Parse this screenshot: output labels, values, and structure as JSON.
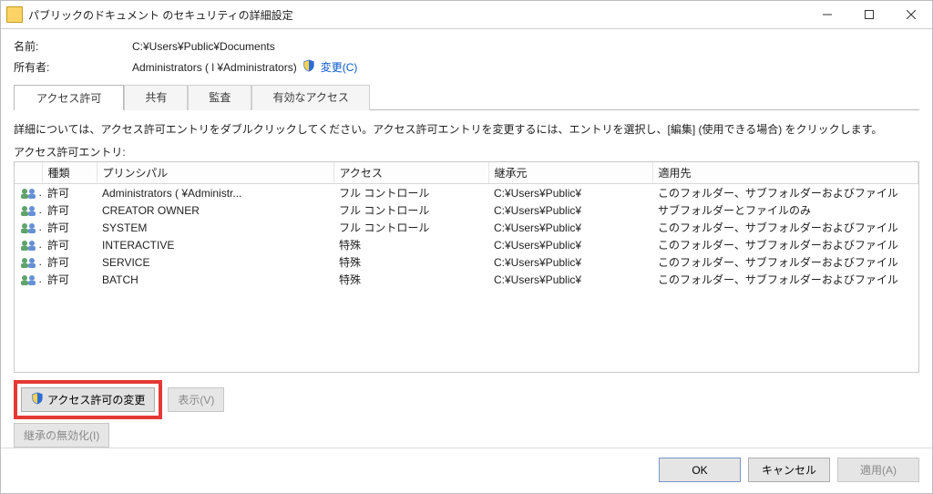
{
  "window": {
    "title": "パブリックのドキュメント のセキュリティの詳細設定"
  },
  "meta": {
    "name_label": "名前:",
    "name_value": "C:¥Users¥Public¥Documents",
    "owner_label": "所有者:",
    "owner_value": "Administrators ( l              ¥Administrators)",
    "change_link": "変更(C)"
  },
  "tabs": {
    "perm": "アクセス許可",
    "share": "共有",
    "audit": "監査",
    "effective": "有効なアクセス"
  },
  "description": "詳細については、アクセス許可エントリをダブルクリックしてください。アクセス許可エントリを変更するには、エントリを選択し、[編集] (使用できる場合) をクリックします。",
  "entries_label": "アクセス許可エントリ:",
  "columns": {
    "icon": "",
    "type": "種類",
    "principal": "プリンシパル",
    "access": "アクセス",
    "inherited": "継承元",
    "applies": "適用先"
  },
  "rows": [
    {
      "type": "許可",
      "principal": "Administrators (               ¥Administr...",
      "access": "フル コントロール",
      "inherited": "C:¥Users¥Public¥",
      "applies": "このフォルダー、サブフォルダーおよびファイル"
    },
    {
      "type": "許可",
      "principal": "CREATOR OWNER",
      "access": "フル コントロール",
      "inherited": "C:¥Users¥Public¥",
      "applies": "サブフォルダーとファイルのみ"
    },
    {
      "type": "許可",
      "principal": "SYSTEM",
      "access": "フル コントロール",
      "inherited": "C:¥Users¥Public¥",
      "applies": "このフォルダー、サブフォルダーおよびファイル"
    },
    {
      "type": "許可",
      "principal": "INTERACTIVE",
      "access": "特殊",
      "inherited": "C:¥Users¥Public¥",
      "applies": "このフォルダー、サブフォルダーおよびファイル"
    },
    {
      "type": "許可",
      "principal": "SERVICE",
      "access": "特殊",
      "inherited": "C:¥Users¥Public¥",
      "applies": "このフォルダー、サブフォルダーおよびファイル"
    },
    {
      "type": "許可",
      "principal": "BATCH",
      "access": "特殊",
      "inherited": "C:¥Users¥Public¥",
      "applies": "このフォルダー、サブフォルダーおよびファイル"
    }
  ],
  "buttons": {
    "change_perm": "アクセス許可の変更",
    "view": "表示(V)",
    "disable_inherit": "継承の無効化(I)",
    "ok": "OK",
    "cancel": "キャンセル",
    "apply": "適用(A)"
  }
}
